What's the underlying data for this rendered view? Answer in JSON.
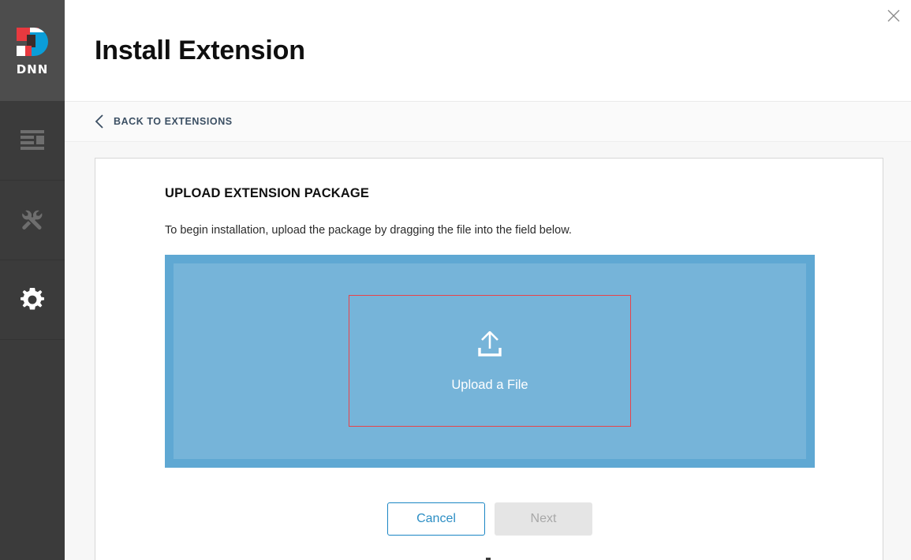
{
  "brand": {
    "wordmark": "DNN",
    "logo_colors": {
      "red": "#e8393f",
      "blue": "#0b9dd8",
      "dark": "#3b2b2b",
      "white": "#ffffff"
    }
  },
  "sidebar": {
    "items": [
      {
        "name": "content",
        "icon": "content-pages-icon",
        "active": false
      },
      {
        "name": "tools",
        "icon": "wrench-tools-icon",
        "active": false
      },
      {
        "name": "settings",
        "icon": "gear-icon",
        "active": true
      }
    ]
  },
  "header": {
    "title": "Install Extension",
    "close_icon": "close-icon"
  },
  "backbar": {
    "chevron_icon": "chevron-left-icon",
    "label": "BACK TO EXTENSIONS"
  },
  "main": {
    "section_title": "UPLOAD EXTENSION PACKAGE",
    "description": "To begin installation, upload the package by dragging the file into the field below.",
    "dropzone": {
      "upload_icon": "upload-icon",
      "label": "Upload a File",
      "outer_color": "#5fa8d3",
      "inner_color": "#76b4d9",
      "highlight_border_color": "#e8434a"
    },
    "buttons": {
      "cancel": "Cancel",
      "next": "Next"
    },
    "accent_color": "#2c8ec4",
    "disabled_color": "#a8a8a8"
  }
}
